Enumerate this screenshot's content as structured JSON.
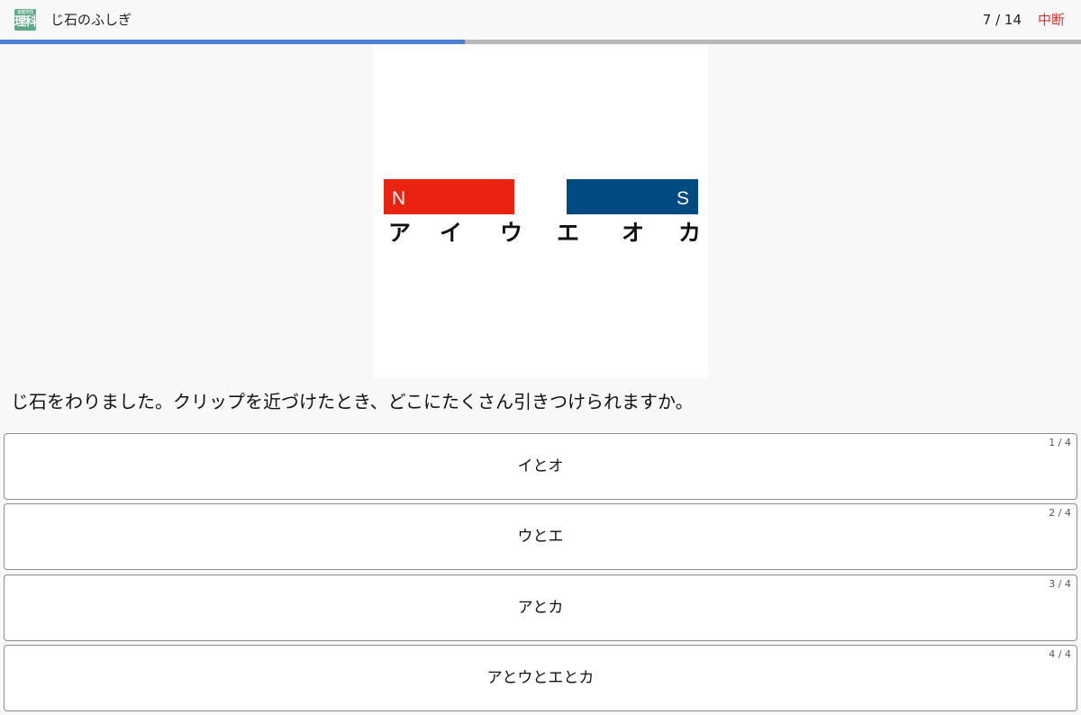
{
  "header": {
    "app_icon_small": "家庭学習",
    "app_icon_big": "理科",
    "title": "じ石のふしぎ",
    "counter": "7 / 14",
    "quit_label": "中断"
  },
  "progress": {
    "fraction": 0.43,
    "fill_color": "#4a7fd4",
    "track_color": "#b8b8b8"
  },
  "figure": {
    "magnet_left_pole": "N",
    "magnet_right_pole": "S",
    "magnet_left_color": "#ea2310",
    "magnet_right_color": "#004a82",
    "labels": [
      "ア",
      "イ",
      "ウ",
      "エ",
      "オ",
      "カ"
    ]
  },
  "question": "じ石をわりました。クリップを近づけたとき、どこにたくさん引きつけられますか。",
  "choices": [
    {
      "text": "イとオ",
      "index": "1 / 4"
    },
    {
      "text": "ウとエ",
      "index": "2 / 4"
    },
    {
      "text": "アとカ",
      "index": "3 / 4"
    },
    {
      "text": "アとウとエとカ",
      "index": "4 / 4"
    }
  ]
}
